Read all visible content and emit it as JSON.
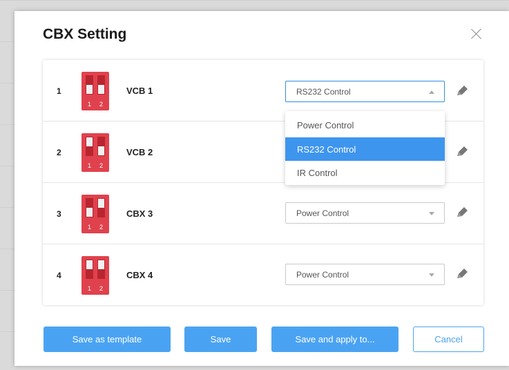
{
  "dialog": {
    "title": "CBX Setting"
  },
  "rows": [
    {
      "index": "1",
      "name": "VCB 1",
      "mode": "RS232 Control",
      "switch_pattern": [
        "down",
        "down"
      ]
    },
    {
      "index": "2",
      "name": "VCB 2",
      "mode": "RS232 Control",
      "switch_pattern": [
        "up",
        "down"
      ]
    },
    {
      "index": "3",
      "name": "CBX 3",
      "mode": "Power Control",
      "switch_pattern": [
        "down",
        "up"
      ]
    },
    {
      "index": "4",
      "name": "CBX 4",
      "mode": "Power Control",
      "switch_pattern": [
        "up",
        "up"
      ]
    }
  ],
  "dip_labels": [
    "1",
    "2"
  ],
  "dropdown": {
    "open_for_row": "1",
    "options": [
      "Power Control",
      "RS232 Control",
      "IR Control"
    ],
    "selected": "RS232 Control"
  },
  "buttons": {
    "save_template": "Save as template",
    "save": "Save",
    "save_apply": "Save and apply to...",
    "cancel": "Cancel"
  },
  "colors": {
    "accent": "#4aa3f2",
    "dip_red": "#e0424d",
    "selected_option": "#3e95ee"
  },
  "icons": {
    "close": "close-icon",
    "edit": "pencil-icon",
    "dip": "dip-switch-icon"
  }
}
